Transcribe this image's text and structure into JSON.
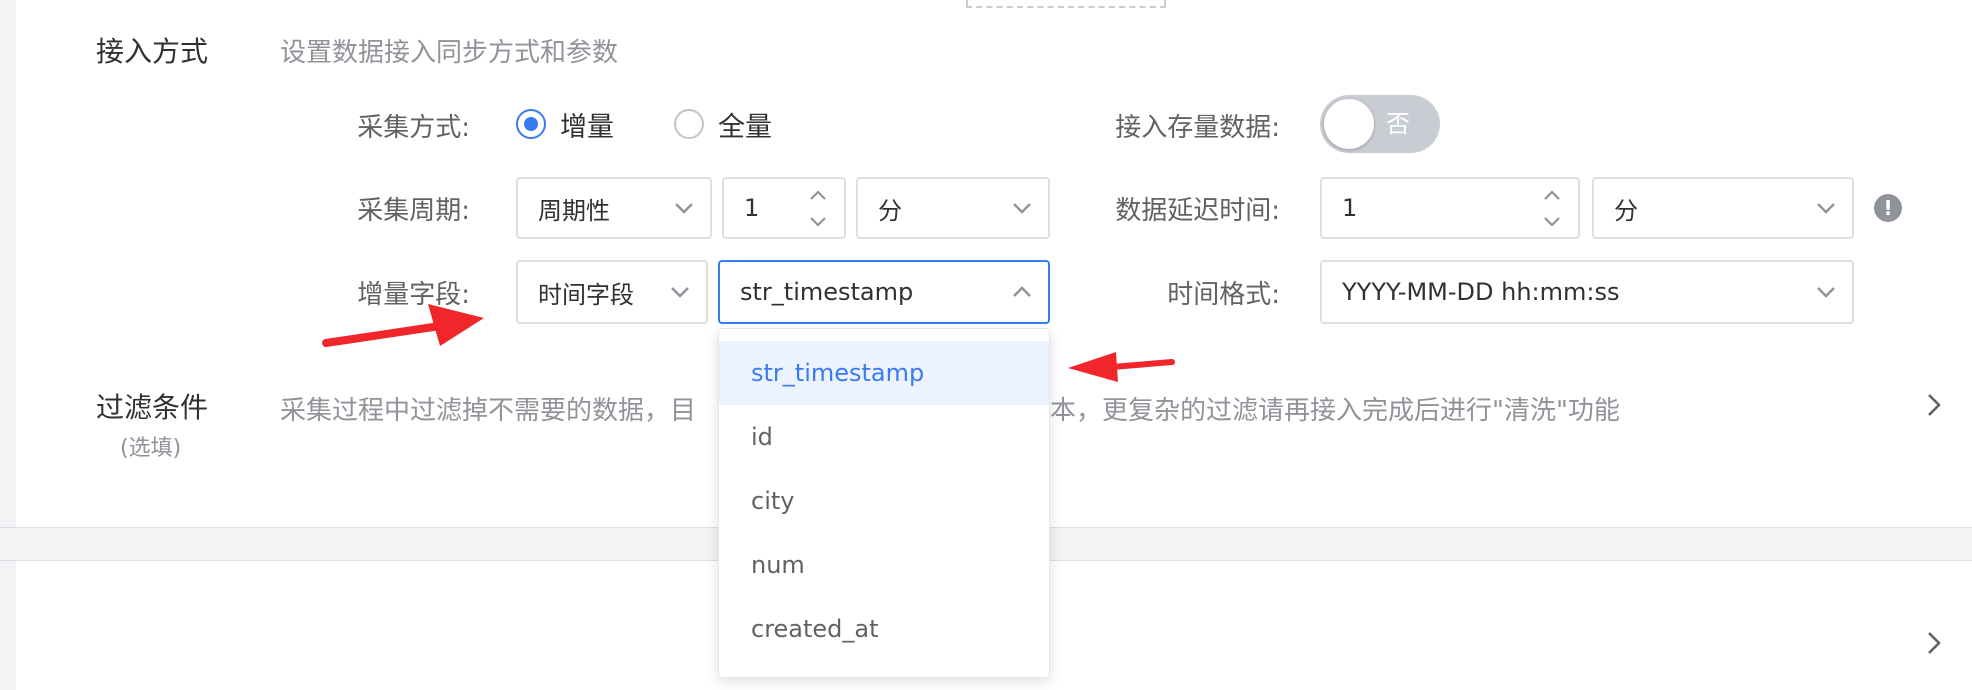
{
  "access": {
    "title": "接入方式",
    "desc": "设置数据接入同步方式和参数",
    "collect_mode_label": "采集方式:",
    "collect_modes": [
      {
        "label": "增量",
        "checked": true
      },
      {
        "label": "全量",
        "checked": false
      }
    ],
    "stock_label": "接入存量数据:",
    "stock_switch_text": "否",
    "stock_switch_on": false,
    "period_label": "采集周期:",
    "period_type": "周期性",
    "period_value": "1",
    "period_unit": "分",
    "delay_label": "数据延迟时间:",
    "delay_value": "1",
    "delay_unit": "分",
    "incr_label": "增量字段:",
    "incr_type": "时间字段",
    "incr_field": "str_timestamp",
    "time_format_label": "时间格式:",
    "time_format": "YYYY-MM-DD hh:mm:ss"
  },
  "filter": {
    "title": "过滤条件",
    "sub": "(选填)",
    "desc_left": "采集过程中过滤掉不需要的数据，目",
    "desc_right": "本，更复杂的过滤请再接入完成后进行\"清洗\"功能"
  },
  "dropdown": {
    "items": [
      "str_timestamp",
      "id",
      "city",
      "num",
      "created_at"
    ],
    "selected_index": 0
  },
  "colors": {
    "primary": "#3a7bf0",
    "annotation_arrow": "#f0262a"
  }
}
